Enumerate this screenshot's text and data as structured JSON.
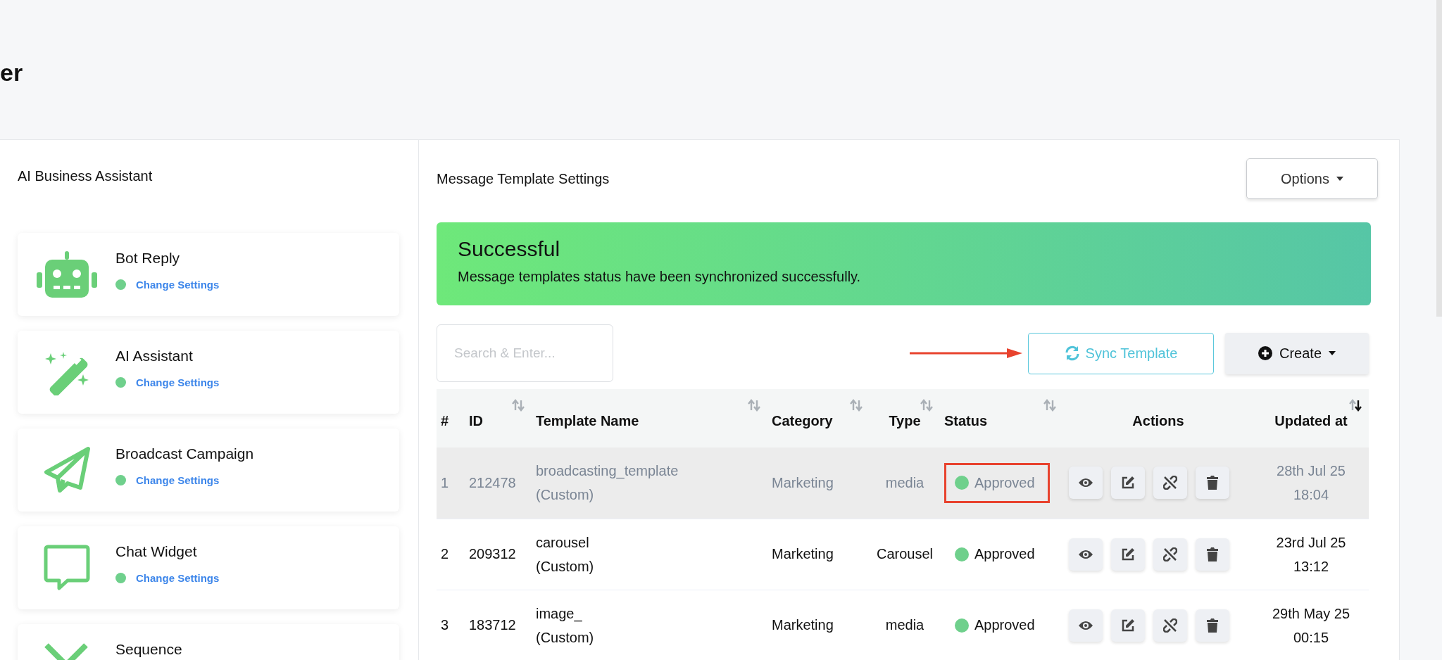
{
  "page": {
    "title": "er"
  },
  "sidebar": {
    "title": "AI Business Assistant",
    "cards": [
      {
        "kind": "robot",
        "title": "Bot Reply",
        "link": "Change Settings",
        "enabled": true
      },
      {
        "kind": "wand",
        "title": "AI Assistant",
        "link": "Change Settings",
        "enabled": true
      },
      {
        "kind": "plane",
        "title": "Broadcast Campaign",
        "link": "Change Settings",
        "enabled": true
      },
      {
        "kind": "chat",
        "title": "Chat Widget",
        "link": "Change Settings",
        "enabled": true
      },
      {
        "kind": "sequence",
        "title": "Sequence"
      }
    ]
  },
  "main": {
    "title": "Message Template Settings",
    "options_button": "Options",
    "alert": {
      "title": "Successful",
      "message": "Message templates status have been synchronized successfully."
    },
    "search": {
      "placeholder": "Search & Enter..."
    },
    "sync_button": "Sync Template",
    "create_button": "Create",
    "table": {
      "columns": [
        {
          "label": "#",
          "sortable": false
        },
        {
          "label": "ID",
          "sortable": true,
          "sorted_descending": false
        },
        {
          "label": "Template Name",
          "sortable": true,
          "sorted_descending": false
        },
        {
          "label": "Category",
          "sortable": true,
          "sorted_descending": false
        },
        {
          "label": "Type",
          "sortable": true,
          "sorted_descending": false
        },
        {
          "label": "Status",
          "sortable": true,
          "sorted_descending": false
        },
        {
          "label": "Actions",
          "sortable": false
        },
        {
          "label": "Updated at",
          "sortable": true,
          "sorted_descending": true
        }
      ],
      "rows": [
        {
          "number": "1",
          "id": "212478",
          "name": "broadcasting_template",
          "tag": "(Custom)",
          "category": "Marketing",
          "type": "media",
          "status": "Approved",
          "updated_date": "28th Jul 25",
          "updated_time": "18:04",
          "selected": true,
          "outlined": true
        },
        {
          "number": "2",
          "id": "209312",
          "name": "carousel",
          "tag": "(Custom)",
          "category": "Marketing",
          "type": "Carousel",
          "status": "Approved",
          "updated_date": "23rd Jul 25",
          "updated_time": "13:12",
          "selected": false,
          "outlined": false
        },
        {
          "number": "3",
          "id": "183712",
          "name": "image_",
          "tag": "(Custom)",
          "category": "Marketing",
          "type": "media",
          "status": "Approved",
          "updated_date": "29th May 25",
          "updated_time": "00:15",
          "selected": false,
          "outlined": false
        }
      ]
    }
  }
}
